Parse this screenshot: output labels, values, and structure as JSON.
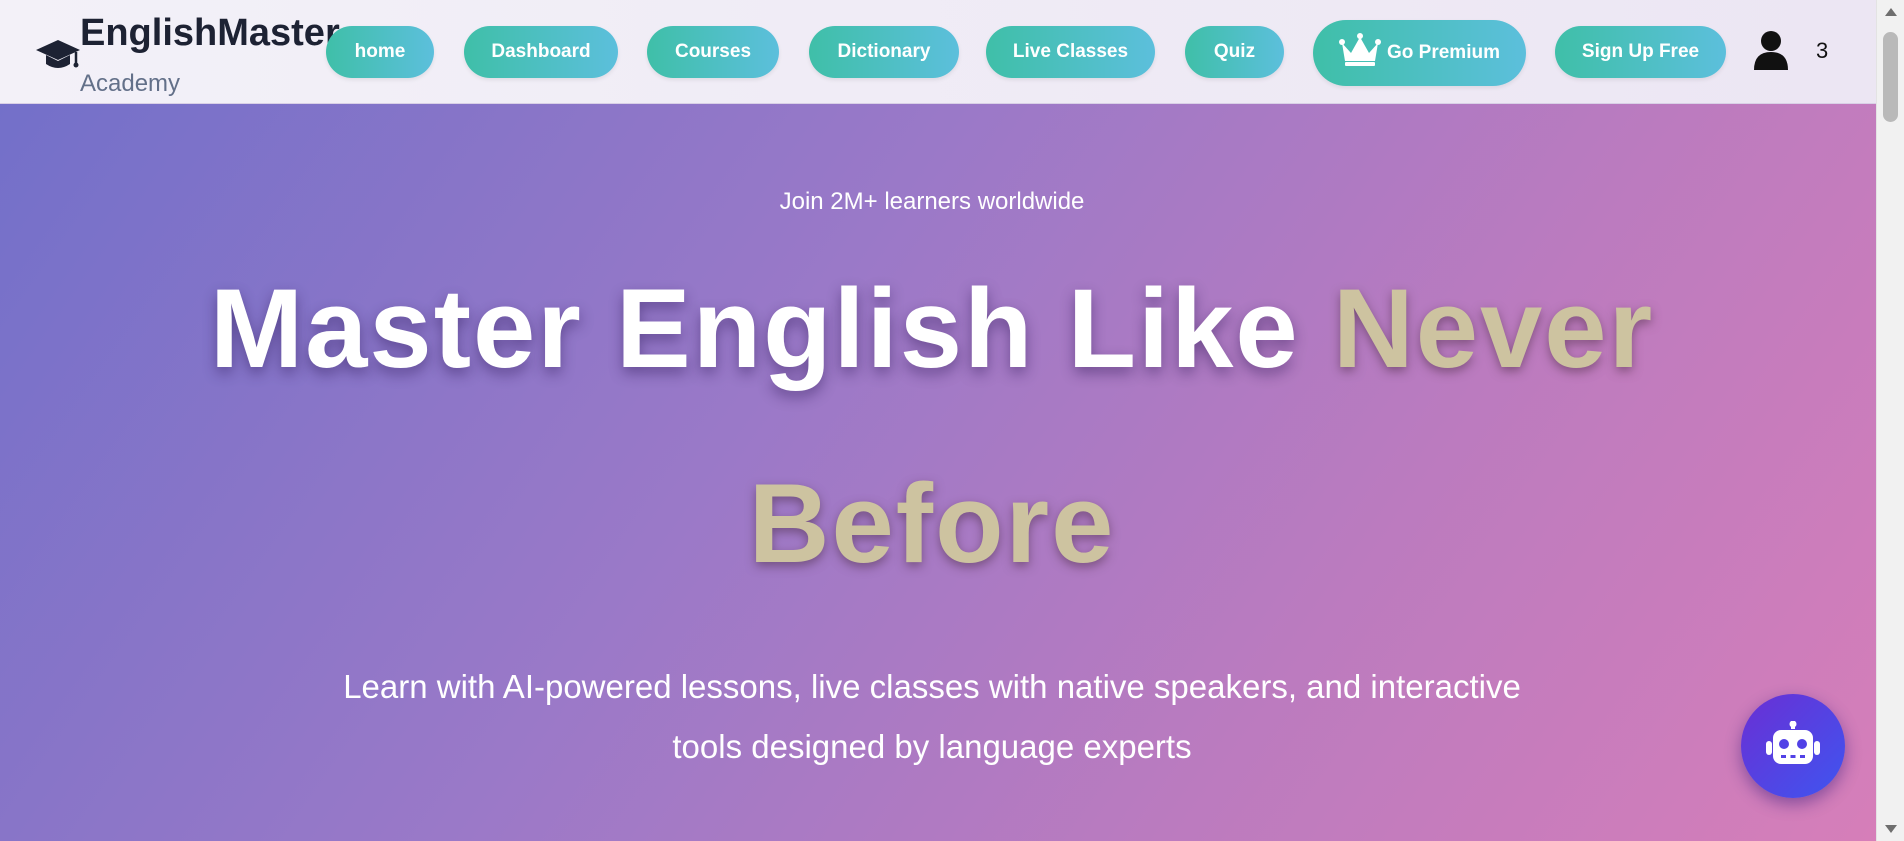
{
  "brand": {
    "title": "EnglishMaster",
    "subtitle": "Academy",
    "icon": "graduation-cap-icon"
  },
  "nav": {
    "items": [
      {
        "label": "home"
      },
      {
        "label": "Dashboard"
      },
      {
        "label": "Courses"
      },
      {
        "label": "Dictionary"
      },
      {
        "label": "Live Classes"
      },
      {
        "label": "Quiz"
      }
    ],
    "premium": {
      "label": "Go Premium",
      "icon": "crown-icon"
    },
    "signup": {
      "label": "Sign Up Free"
    },
    "user": {
      "icon": "user-icon",
      "count": "3"
    }
  },
  "hero": {
    "tagline": "Join 2M+ learners worldwide",
    "headline_main": "Master English Like ",
    "headline_accent_1": "Never",
    "headline_accent_2": "Before",
    "description": "Learn with AI-powered lessons, live classes with native speakers, and interactive tools designed by language experts"
  },
  "chatbot": {
    "icon": "robot-icon"
  },
  "colors": {
    "nav_button_start": "#3fbfa8",
    "nav_button_end": "#5cbfdc",
    "hero_start": "#7370c9",
    "hero_end": "#d67eb9",
    "headline_accent": "#cdc3a0",
    "chatbot_start": "#6a2fd4",
    "chatbot_end": "#3f55f0"
  }
}
